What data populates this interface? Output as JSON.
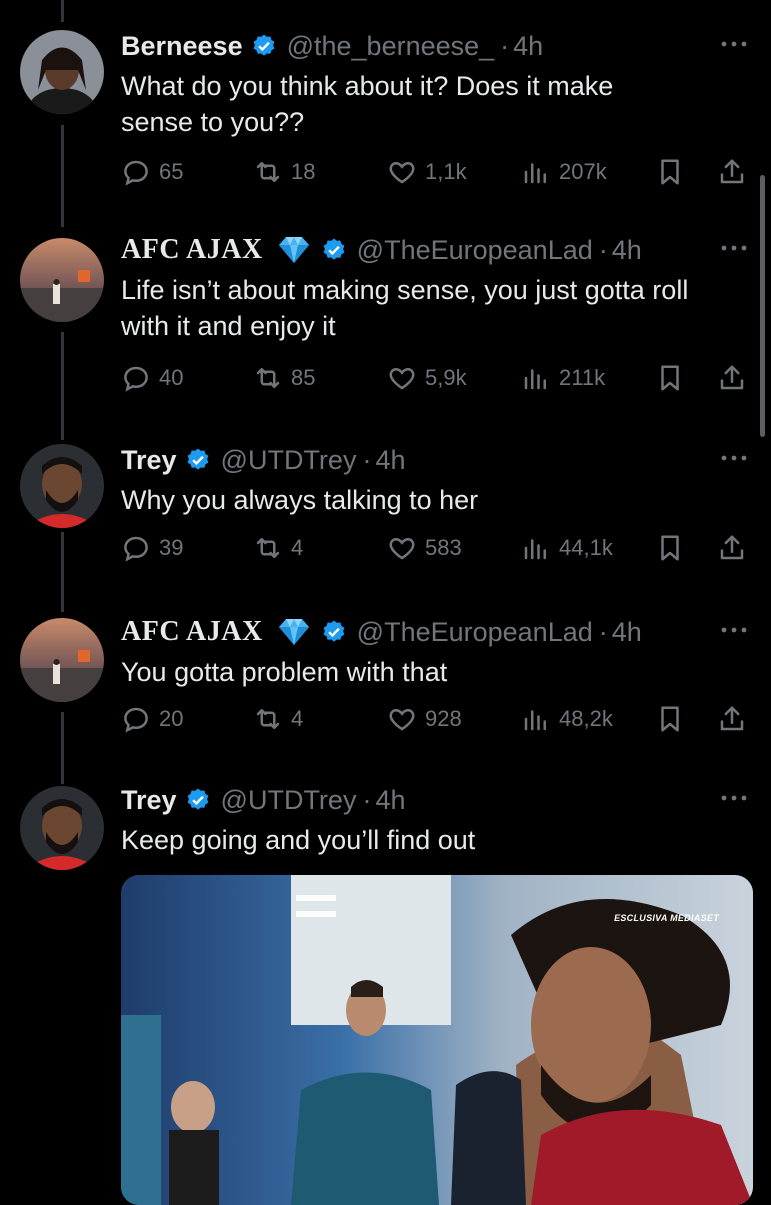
{
  "tweets": [
    {
      "name": "Berneese",
      "handle": "@the_berneese_",
      "time": "4h",
      "text": "What do you think about it? Does it make sense to you??",
      "replies": "65",
      "retweets": "18",
      "likes": "1,1k",
      "views": "207k"
    },
    {
      "name": "AFC AJAX",
      "handle": "@TheEuropeanLad",
      "time": "4h",
      "text": "Life isn’t about making sense, you just gotta roll with it and enjoy it",
      "replies": "40",
      "retweets": "85",
      "likes": "5,9k",
      "views": "211k"
    },
    {
      "name": "Trey",
      "handle": "@UTDTrey",
      "time": "4h",
      "text": "Why you always talking to her",
      "replies": "39",
      "retweets": "4",
      "likes": "583",
      "views": "44,1k"
    },
    {
      "name": "AFC AJAX",
      "handle": "@TheEuropeanLad",
      "time": "4h",
      "text": "You gotta problem with that",
      "replies": "20",
      "retweets": "4",
      "likes": "928",
      "views": "48,2k"
    },
    {
      "name": "Trey",
      "handle": "@UTDTrey",
      "time": "4h",
      "text": "Keep going and you’ll find out"
    }
  ],
  "media": {
    "watermark": "ESCLUSIVA MEDIASET"
  },
  "colors": {
    "accent": "#1d9bf0",
    "muted": "#71767b",
    "text": "#e7e9ea",
    "bg": "#000000"
  },
  "icons": {
    "verified": "verified-badge-icon",
    "gem": "diamond-emoji-icon",
    "reply": "reply-icon",
    "retweet": "retweet-icon",
    "like": "heart-icon",
    "views": "views-icon",
    "bookmark": "bookmark-icon",
    "share": "share-icon",
    "more": "more-icon"
  }
}
